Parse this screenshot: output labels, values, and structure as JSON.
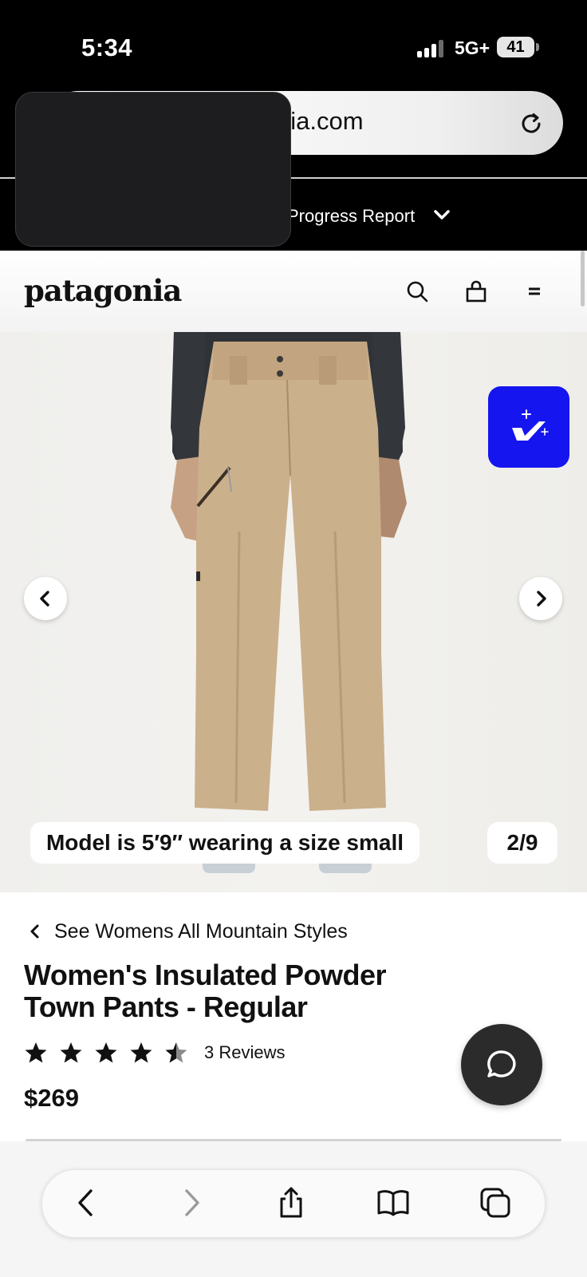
{
  "status_bar": {
    "time": "5:34",
    "network": "5G+",
    "battery": "41"
  },
  "browser": {
    "url": "nia.com",
    "promo_text": "Progress Report"
  },
  "site": {
    "logo": "patagonia",
    "header_icons": [
      "search-icon",
      "bag-icon",
      "menu-icon"
    ]
  },
  "gallery": {
    "caption": "Model is 5′9″ wearing a size small",
    "counter": "2/9"
  },
  "product": {
    "back_link": "See Womens All Mountain Styles",
    "title": "Women's Insulated Powder Town Pants - Regular",
    "rating": 4.5,
    "reviews": "3 Reviews",
    "price": "$269"
  },
  "colors": {
    "accent_badge": "#1515f0",
    "pants": "#cbb08c",
    "chat": "#2b2b2b"
  },
  "toolbar": {
    "icons": [
      "back-icon",
      "forward-icon",
      "share-icon",
      "bookmarks-icon",
      "tabs-icon"
    ]
  }
}
